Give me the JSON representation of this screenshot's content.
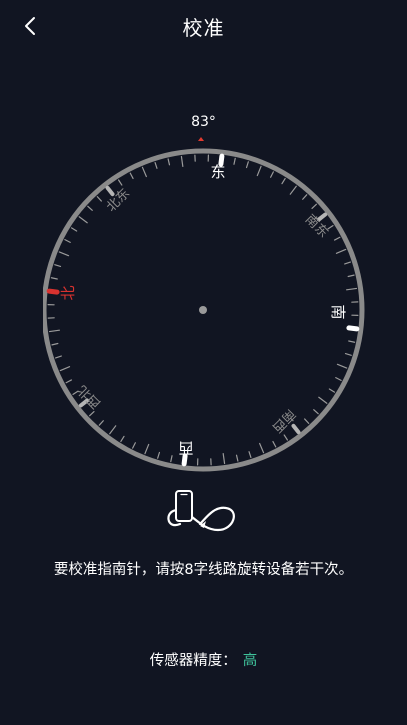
{
  "header": {
    "title": "校准",
    "back_icon": "chevron-left-icon"
  },
  "compass": {
    "heading": "83°",
    "heading_value": 83,
    "labels": {
      "north": "北",
      "northeast": "北东",
      "east": "东",
      "southeast": "南东",
      "south": "南",
      "southwest": "南西",
      "west": "西",
      "northwest": "西北"
    },
    "north_color": "#d8322f",
    "ring_color": "#8a8a8a",
    "marker_color": "#e03a2f"
  },
  "calibration": {
    "icon": "figure-eight-phone-icon",
    "instruction": "要校准指南针，请按8字线路旋转设备若干次。"
  },
  "sensor": {
    "accuracy_label": "传感器精度：",
    "accuracy_value": "高",
    "accuracy_color": "#3fc19a"
  }
}
